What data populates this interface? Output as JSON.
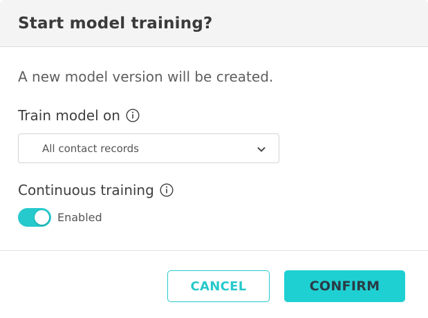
{
  "dialog": {
    "title": "Start model training?",
    "description": "A new model version will be created.",
    "train_model_on": {
      "label": "Train model on",
      "info_icon": "info-circle-icon",
      "selected_value": "All contact records",
      "dropdown_icon": "chevron-down-icon"
    },
    "continuous_training": {
      "label": "Continuous training",
      "info_icon": "info-circle-icon",
      "toggle_state": "on",
      "toggle_text": "Enabled"
    },
    "buttons": {
      "cancel_label": "CANCEL",
      "confirm_label": "CONFIRM"
    },
    "colors": {
      "accent": "#26c9cc",
      "header_bg": "#f4f4f4"
    }
  }
}
